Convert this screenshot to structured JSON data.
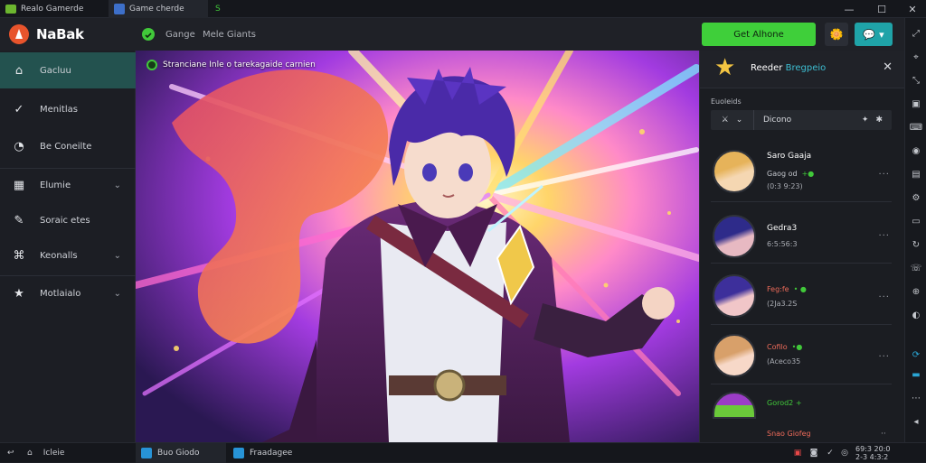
{
  "titlebar": {
    "app_name": "Realo Gamerde",
    "tab_active": "Game cherde",
    "tab_icon": "S",
    "window_controls": [
      "—",
      "☐",
      "✕"
    ]
  },
  "header": {
    "logo": "NaBak",
    "links": [
      "Gange",
      "Mele Giants"
    ],
    "cta": "Get Alhone",
    "icon1": "🌼",
    "icon2": "💬"
  },
  "sidebar": {
    "items": [
      {
        "label": "Gacluu",
        "icon": "home-icon",
        "glyph": "⌂",
        "active": true,
        "chevron": false
      },
      {
        "label": "Menitlas",
        "icon": "chat-icon",
        "glyph": "✓",
        "active": false,
        "chevron": false
      },
      {
        "label": "Be Coneilte",
        "icon": "compass-icon",
        "glyph": "◔",
        "active": false,
        "chevron": false
      },
      {
        "label": "Elumie",
        "icon": "folder-icon",
        "glyph": "▦",
        "active": false,
        "chevron": true
      },
      {
        "label": "Soraic etes",
        "icon": "character-icon",
        "glyph": "✎",
        "active": false,
        "chevron": false
      },
      {
        "label": "Keonalls",
        "icon": "puzzle-icon",
        "glyph": "⌘",
        "active": false,
        "chevron": true
      },
      {
        "label": "Motlaialo",
        "icon": "star-icon",
        "glyph": "★",
        "active": false,
        "chevron": true
      }
    ]
  },
  "main": {
    "caption": "Stranciane Inle o tarekagaide carnien"
  },
  "panel": {
    "title_prefix": "Reeder",
    "title_accent": "Bregpeio",
    "section_label": "Euoleids",
    "filter_value": "Dicono",
    "filter_select_icon": "sword-icon",
    "users": [
      {
        "name": "Saro Gaaja",
        "sub": "Gaog od",
        "tag": "+●",
        "meta": "(0:3 9:23)",
        "colors": [
          "#e6b35a",
          "#f5d7b2"
        ]
      },
      {
        "name": "Gedra3",
        "sub": "",
        "tag": "",
        "meta": "6:5:56:3",
        "colors": [
          "#2e2b8a",
          "#e7b9c2"
        ]
      },
      {
        "name": "",
        "sub": "Feg:fe",
        "tag": "• ●",
        "meta": "(2Ja3.2S",
        "colors": [
          "#3d2f9b",
          "#f1c6c8"
        ],
        "sub_color": "#ee6b5a"
      },
      {
        "name": "",
        "sub": "Cofilo",
        "tag": "•●",
        "meta": "(Aceco35",
        "colors": [
          "#d8a06a",
          "#f7d8c8"
        ],
        "sub_color": "#ee6b5a"
      },
      {
        "name": "",
        "sub": "Gorod2 +",
        "tag": "",
        "meta": "",
        "colors": [
          "#9b3cc6",
          "#6bc93a"
        ],
        "sub_color": "#41c93a"
      }
    ],
    "footer_text": "Snao Giofeg"
  },
  "taskbar": {
    "left_label": "Icleie",
    "tasks": [
      "Buo Giodo",
      "Fraadagee"
    ],
    "time": "69:3 20:0",
    "date": "2-3 4:3:2"
  },
  "colors": {
    "accent_green": "#41c93a",
    "accent_teal": "#1fa3a8",
    "sidebar_active": "#23524f",
    "bg": "#1b1d23"
  }
}
